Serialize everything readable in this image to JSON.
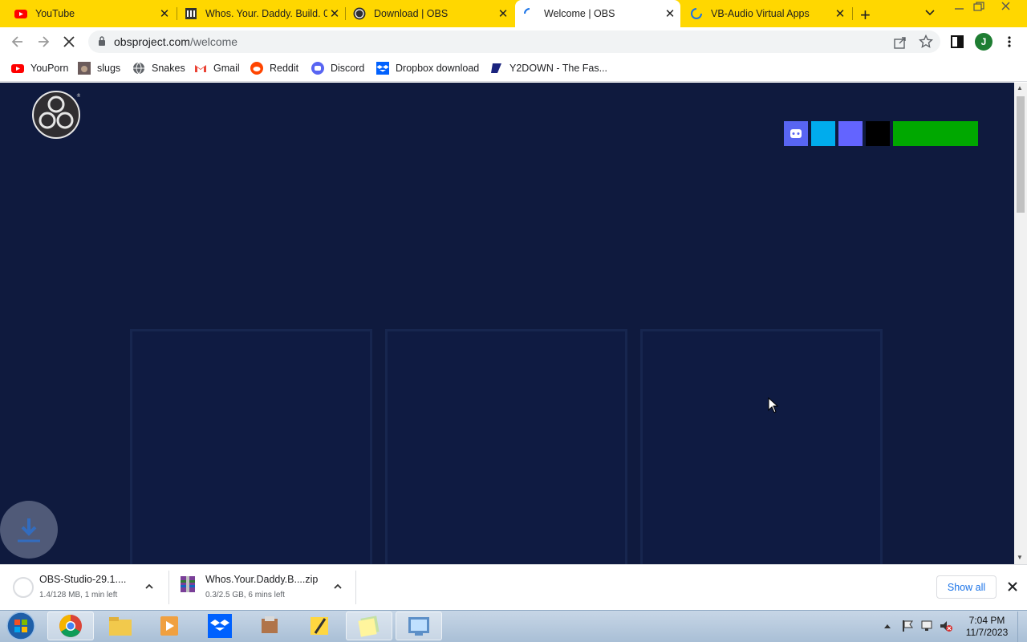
{
  "browser": {
    "tabs": [
      {
        "label": "YouTube",
        "icon": "youtube-icon"
      },
      {
        "label": "Whos. Your. Daddy. Build. 0",
        "icon": "bank-icon"
      },
      {
        "label": "Download | OBS",
        "icon": "obs-icon"
      },
      {
        "label": "Welcome | OBS",
        "icon": "loading-spinner-icon",
        "active": true
      },
      {
        "label": "VB-Audio Virtual Apps",
        "icon": "loading-spinner-icon"
      }
    ],
    "new_tab": "+",
    "address": {
      "domain": "obsproject.com",
      "path": "/welcome"
    },
    "profile_initial": "J",
    "bookmarks": [
      {
        "label": "YouPorn",
        "icon": "youtube-icon"
      },
      {
        "label": "slugs",
        "icon": "slug-icon"
      },
      {
        "label": "Snakes",
        "icon": "globe-icon"
      },
      {
        "label": "Gmail",
        "icon": "gmail-icon"
      },
      {
        "label": "Reddit",
        "icon": "reddit-icon"
      },
      {
        "label": "Discord",
        "icon": "discord-icon"
      },
      {
        "label": "Dropbox download",
        "icon": "dropbox-icon"
      },
      {
        "label": "Y2DOWN - The Fas...",
        "icon": "y2down-icon"
      }
    ]
  },
  "page": {
    "social_colors": [
      "#5865f2",
      "#00aced",
      "#6364ff",
      "#000000",
      "#00a800"
    ],
    "background": "#0f1a3e"
  },
  "downloads": [
    {
      "name": "OBS-Studio-29.1....",
      "status": "1.4/128 MB, 1 min left"
    },
    {
      "name": "Whos.Your.Daddy.B....zip",
      "status": "0.3/2.5 GB, 6 mins left"
    }
  ],
  "show_all": "Show all",
  "clock": {
    "time": "7:04 PM",
    "date": "11/7/2023"
  }
}
